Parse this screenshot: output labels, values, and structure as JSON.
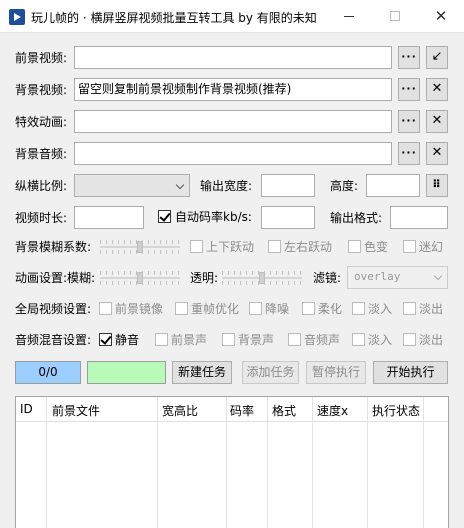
{
  "window": {
    "title": "玩儿帧的 · 横屏竖屏视频批量互转工具  by 有限的未知",
    "minimize": "—",
    "close": "✕"
  },
  "fields": {
    "foreground_video": {
      "label": "前景视频:",
      "value": "",
      "browse": "···",
      "action": "↙"
    },
    "background_video": {
      "label": "背景视频:",
      "value": "留空则复制前景视频制作背景视频(推荐)",
      "browse": "···",
      "clear": "✕"
    },
    "effect_animation": {
      "label": "特效动画:",
      "value": "",
      "browse": "···",
      "clear": "✕"
    },
    "background_audio": {
      "label": "背景音频:",
      "value": "",
      "browse": "···",
      "clear": "✕"
    }
  },
  "row_ratio": {
    "aspect_label": "纵横比例:",
    "aspect_value": "",
    "out_width_label": "输出宽度:",
    "out_width_value": "",
    "height_label": "高度:",
    "height_value": "",
    "grid_button": "⠿"
  },
  "row_duration": {
    "duration_label": "视频时长:",
    "duration_value": "",
    "auto_bitrate_label": "自动码率kb/s:",
    "auto_bitrate_checked": true,
    "bitrate_value": "",
    "format_label": "输出格式:",
    "format_value": ""
  },
  "row_blur": {
    "label": "背景模糊系数:",
    "options": [
      "上下跃动",
      "左右跃动",
      "色变",
      "迷幻"
    ]
  },
  "row_anim": {
    "label": "动画设置:模糊:",
    "transparency_label": "透明:",
    "filter_label": "滤镜:",
    "filter_value": "overlay"
  },
  "row_global": {
    "label": "全局视频设置:",
    "options": [
      "前景镜像",
      "重帧优化",
      "降噪",
      "柔化",
      "淡入",
      "淡出"
    ]
  },
  "row_audio": {
    "label": "音频混音设置:",
    "mute_label": "静音",
    "mute_checked": true,
    "options": [
      "前景声",
      "背景声",
      "音频声",
      "淡入",
      "淡出"
    ]
  },
  "actions": {
    "progress_text": "0/0",
    "progress_color": "#9ccfff",
    "status_color": "#b8fbb8",
    "new_task": "新建任务",
    "add_task": "添加任务",
    "pause": "暂停执行",
    "start": "开始执行"
  },
  "table": {
    "columns": [
      "ID",
      "前景文件",
      "宽高比",
      "码率",
      "格式",
      "速度x",
      "执行状态"
    ]
  }
}
